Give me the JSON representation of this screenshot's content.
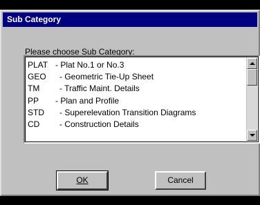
{
  "window": {
    "title": "Sub Category"
  },
  "prompt": "Please choose Sub Category:",
  "list": {
    "items": [
      {
        "code": "PLAT",
        "desc": "- Plat No.1 or No.3"
      },
      {
        "code": "GEO",
        "desc": "- Geometric Tie-Up Sheet"
      },
      {
        "code": "TM",
        "desc": "- Traffic Maint. Details"
      },
      {
        "code": "PP",
        "desc": "- Plan and Profile"
      },
      {
        "code": "STD",
        "desc": "- Superelevation Transition Diagrams"
      },
      {
        "code": "CD",
        "desc": "- Construction Details"
      }
    ]
  },
  "buttons": {
    "ok": "OK",
    "cancel": "Cancel"
  },
  "colors": {
    "titlebar": "#000080",
    "window": "#c0c0c0",
    "background": "#000000"
  }
}
